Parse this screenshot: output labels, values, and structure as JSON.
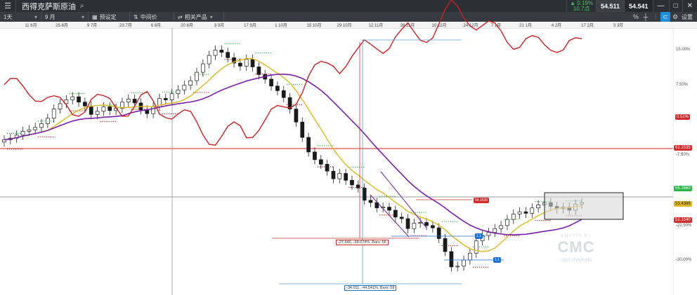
{
  "header": {
    "menu_icon": "hamburger-icon",
    "instrument": "西得克萨斯原油",
    "search_icon": "search-icon",
    "change_pct": "▲ 0.19%",
    "change_abs": "10.7点",
    "sell_price": "54.511",
    "buy_price": "54.541",
    "minimize_icon": "minimize-icon",
    "maximize_icon": "maximize-icon",
    "close_icon": "close-icon"
  },
  "toolbar": {
    "timeframe": "1天",
    "range": "9 月",
    "preset": "预设定",
    "price_type": "中间价",
    "related": "相关产品",
    "settings_label": "设置"
  },
  "chart_data": {
    "type": "candlestick",
    "x_dates": [
      "11 6月",
      "25 6月",
      "9 7月",
      "23 7月",
      "6 8月",
      "20 8月",
      "3 9月",
      "17 9月",
      "1 10月",
      "15 10月",
      "29 10月",
      "12 11月",
      "26 11月",
      "10 12月",
      "24 12月",
      "7 1月",
      "21 1月",
      "4 2月",
      "17 2月",
      "3 3月"
    ],
    "y_ticks_right": [
      "15.00%",
      "7.50%",
      "-7.50%",
      "-22.50%",
      "-30.00%"
    ],
    "price_labels": {
      "comparison_pct": "0.51%",
      "red_line": "61.1535",
      "grey_line": "55.1660",
      "current": "53.4386",
      "lower": "51.1540"
    },
    "annotations": {
      "box_top": "54.1535",
      "measure1": "-27.646, -38.074%, Bars:  56",
      "measure2": "-34.011, -44.541%, Bars:  58",
      "blue_tag1": "1.1",
      "blue_tag2": "1.1"
    },
    "price_series": [
      62.8,
      63.0,
      63.4,
      63.9,
      64.1,
      64.4,
      64.9,
      65.6,
      66.8,
      67.5,
      68.0,
      68.4,
      67.7,
      67.2,
      66.1,
      66.5,
      67.1,
      66.6,
      66.9,
      67.7,
      68.1,
      67.6,
      66.7,
      66.2,
      67.1,
      68.2,
      68.0,
      68.8,
      69.3,
      69.9,
      70.5,
      71.6,
      72.7,
      73.8,
      74.5,
      74.2,
      73.5,
      72.8,
      72.4,
      73.3,
      72.3,
      71.3,
      70.7,
      69.8,
      69.2,
      68.3,
      66.8,
      65.1,
      63.1,
      61.2,
      60.2,
      59.6,
      58.7,
      57.7,
      58.4,
      57.5,
      56.9,
      56.5,
      54.9,
      54.6,
      53.9,
      54.0,
      53.6,
      52.7,
      52.5,
      51.2,
      51.9,
      52.0,
      51.6,
      51.3,
      49.9,
      48.2,
      46.2,
      46.3,
      47.1,
      48.0,
      49.6,
      50.3,
      50.7,
      51.2,
      51.6,
      52.4,
      53.1,
      53.4,
      53.2,
      53.9,
      54.3,
      54.6,
      54.1,
      53.8,
      54.0,
      53.6,
      54.4,
      54.6
    ],
    "series": [
      {
        "name": "",
        "color": "#e0b820"
      },
      {
        "name": "",
        "color": "#7a1fa8"
      },
      {
        "name": "",
        "color": "#cc2222"
      }
    ],
    "watermark": {
      "line1": "CHARTS BY",
      "line2": "CMC",
      "line3": "cmc markets"
    }
  }
}
